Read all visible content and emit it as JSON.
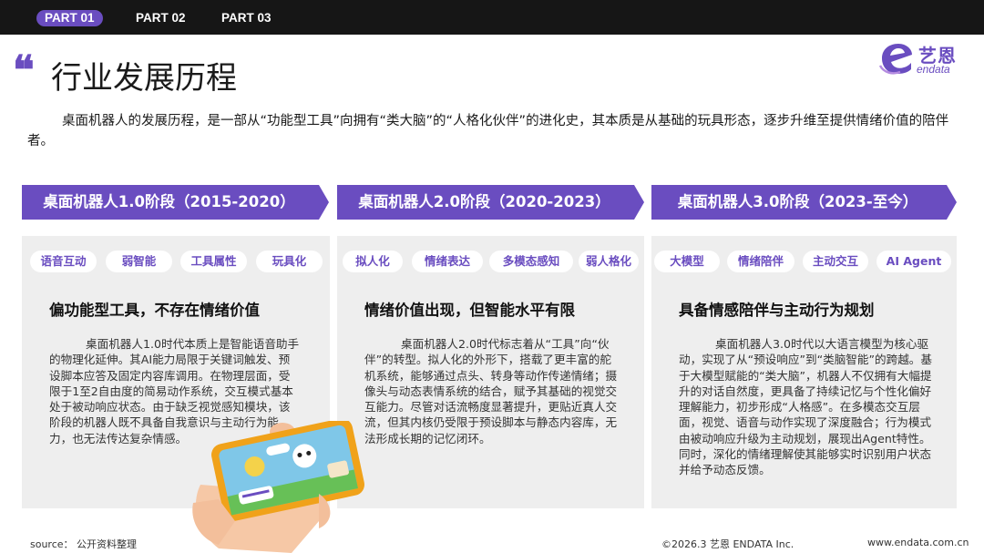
{
  "nav": {
    "tabs": [
      {
        "label": "PART 01",
        "active": true
      },
      {
        "label": "PART 02",
        "active": false
      },
      {
        "label": "PART 03",
        "active": false
      }
    ]
  },
  "title": "行业发展历程",
  "logo": {
    "cn": "艺恩",
    "en": "endata"
  },
  "intro": "桌面机器人的发展历程，是一部从“功能型工具”向拥有“类大脑”的“人格化伙伴”的进化史，其本质是从基础的玩具形态，逐步升维至提供情绪价值的陪伴者。",
  "stages": [
    {
      "header": "桌面机器人1.0阶段（2015-2020）",
      "tags": [
        "语音互动",
        "弱智能",
        "工具属性",
        "玩具化"
      ],
      "heading": "偏功能型工具，不存在情绪价值",
      "body": "桌面机器人1.0时代本质上是智能语音助手的物理化延伸。其AI能力局限于关键词触发、预设脚本应答及固定内容库调用。在物理层面，受限于1至2自由度的简易动作系统，交互模式基本处于被动响应状态。由于缺乏视觉感知模块，该阶段的机器人既不具备自我意识与主动行为能力，也无法传达复杂情感。"
    },
    {
      "header": "桌面机器人2.0阶段（2020-2023）",
      "tags": [
        "拟人化",
        "情绪表达",
        "多模态感知",
        "弱人格化"
      ],
      "heading": "情绪价值出现，但智能水平有限",
      "body": "桌面机器人2.0时代标志着从“工具”向“伙伴”的转型。拟人化的外形下，搭载了更丰富的舵机系统，能够通过点头、转身等动作传递情绪；摄像头与动态表情系统的结合，赋予其基础的视觉交互能力。尽管对话流畅度显著提升，更贴近真人交流，但其内核仍受限于预设脚本与静态内容库，无法形成长期的记忆闭环。"
    },
    {
      "header": "桌面机器人3.0阶段（2023-至今）",
      "tags": [
        "大模型",
        "情绪陪伴",
        "主动交互",
        "AI Agent"
      ],
      "heading": "具备情感陪伴与主动行为规划",
      "body": "桌面机器人3.0时代以大语言模型为核心驱动，实现了从“预设响应”到“类脑智能”的跨越。基于大模型赋能的“类大脑”，机器人不仅拥有大幅提升的对话自然度，更具备了持续记忆与个性化偏好理解能力，初步形成“人格感”。在多模态交互层面，视觉、语音与动作实现了深度融合；行为模式由被动响应升级为主动规划，展现出Agent特性。同时，深化的情绪理解使其能够实时识别用户状态并给予动态反馈。"
    }
  ],
  "footer": {
    "source": "source： 公开资料整理",
    "copyright": "©2026.3  艺恩 ENDATA Inc.",
    "website": "www.endata.com.cn"
  },
  "colors": {
    "accent": "#6a4dc0",
    "topbar": "#161616",
    "panel_bg": "#eeeeee"
  }
}
